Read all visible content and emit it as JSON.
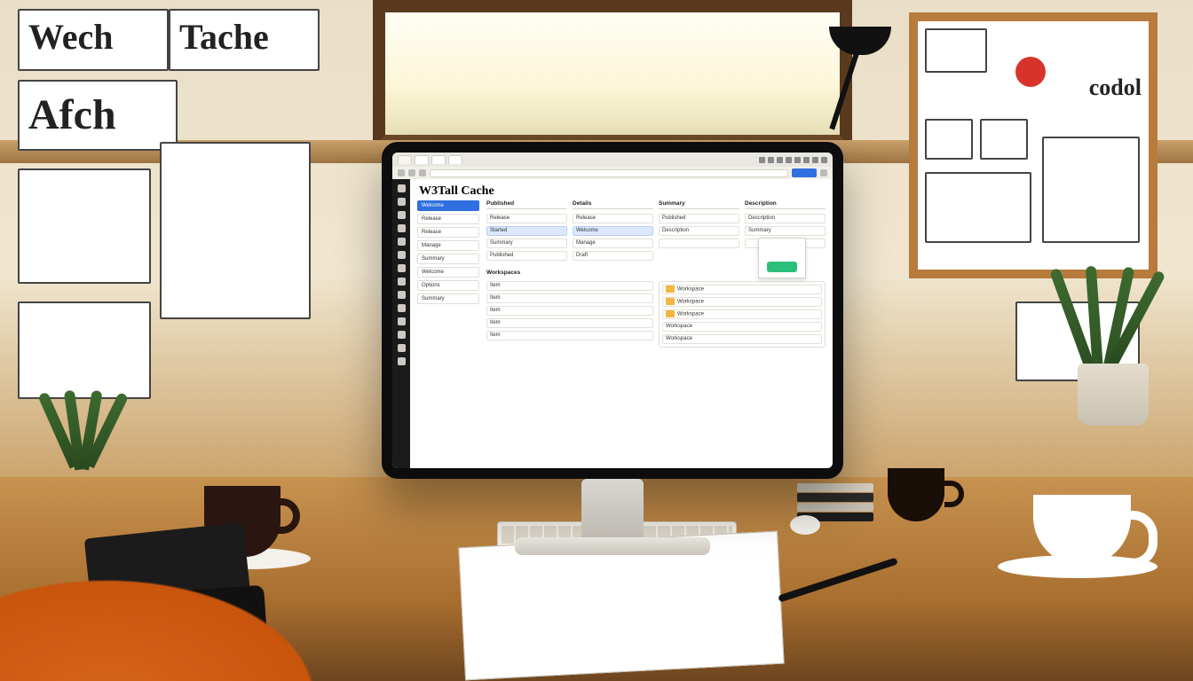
{
  "wall": {
    "note_top_left": "Wech",
    "note_mid_left": "Afch",
    "note_top_mid": "Tache",
    "note_right_small": "codol"
  },
  "browser": {
    "tabs": [
      "",
      "",
      "",
      ""
    ],
    "address_placeholder": "",
    "primary_button": ""
  },
  "rail_icons": [
    "home",
    "files",
    "search",
    "source",
    "debug",
    "ext",
    "acct",
    "gear",
    "a",
    "b",
    "c",
    "d",
    "e",
    "f"
  ],
  "app": {
    "title": "W3Tall Cache",
    "sidebar": {
      "items": [
        {
          "label": "Welcome",
          "active": true
        },
        {
          "label": "Release"
        },
        {
          "label": "Release"
        },
        {
          "label": "Manage"
        },
        {
          "label": "Summary"
        },
        {
          "label": "Welcome"
        },
        {
          "label": "Options"
        },
        {
          "label": "Summary"
        }
      ]
    },
    "columns": {
      "headers": [
        "Published",
        "Details",
        "Summary",
        "Description"
      ],
      "rows": [
        [
          "Release",
          "Release",
          "",
          ""
        ],
        [
          "Started",
          "Welcome",
          "Published",
          "Description"
        ],
        [
          "Summary",
          "Manage",
          "",
          ""
        ],
        [
          "Published",
          "Draft",
          "Description",
          "Summary"
        ],
        [
          "",
          "",
          "",
          ""
        ]
      ]
    },
    "lower_section_title": "Workspaces",
    "lower_left": [
      "Item",
      "Item",
      "Item",
      "Item",
      "Item"
    ],
    "lower_right_box": {
      "rows": [
        "Workspace",
        "Workspace",
        "Workspace",
        "Workspace",
        "Workspace"
      ]
    },
    "card_button": ""
  }
}
